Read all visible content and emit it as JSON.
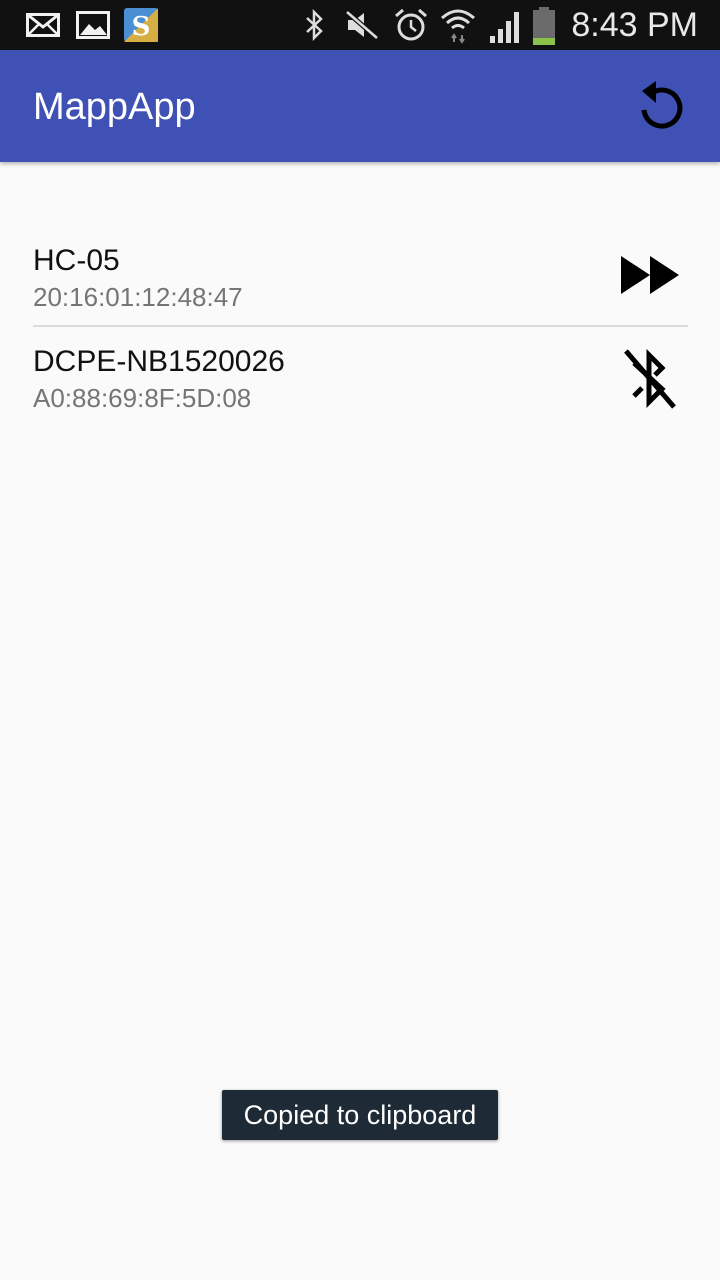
{
  "status_bar": {
    "time": "8:43 PM",
    "icons": [
      "mail-icon",
      "gallery-icon",
      "s-app-icon",
      "bluetooth-icon",
      "mute-icon",
      "alarm-icon",
      "wifi-icon",
      "signal-icon",
      "battery-icon"
    ]
  },
  "app_bar": {
    "title": "MappApp",
    "action_icon": "refresh-icon",
    "color": "#3f51b5"
  },
  "devices": [
    {
      "name": "HC-05",
      "address": "20:16:01:12:48:47",
      "action_icon": "fast-forward-icon"
    },
    {
      "name": "DCPE-NB1520026",
      "address": "A0:88:69:8F:5D:08",
      "action_icon": "bluetooth-disabled-icon"
    }
  ],
  "toast": {
    "text": "Copied to clipboard"
  }
}
